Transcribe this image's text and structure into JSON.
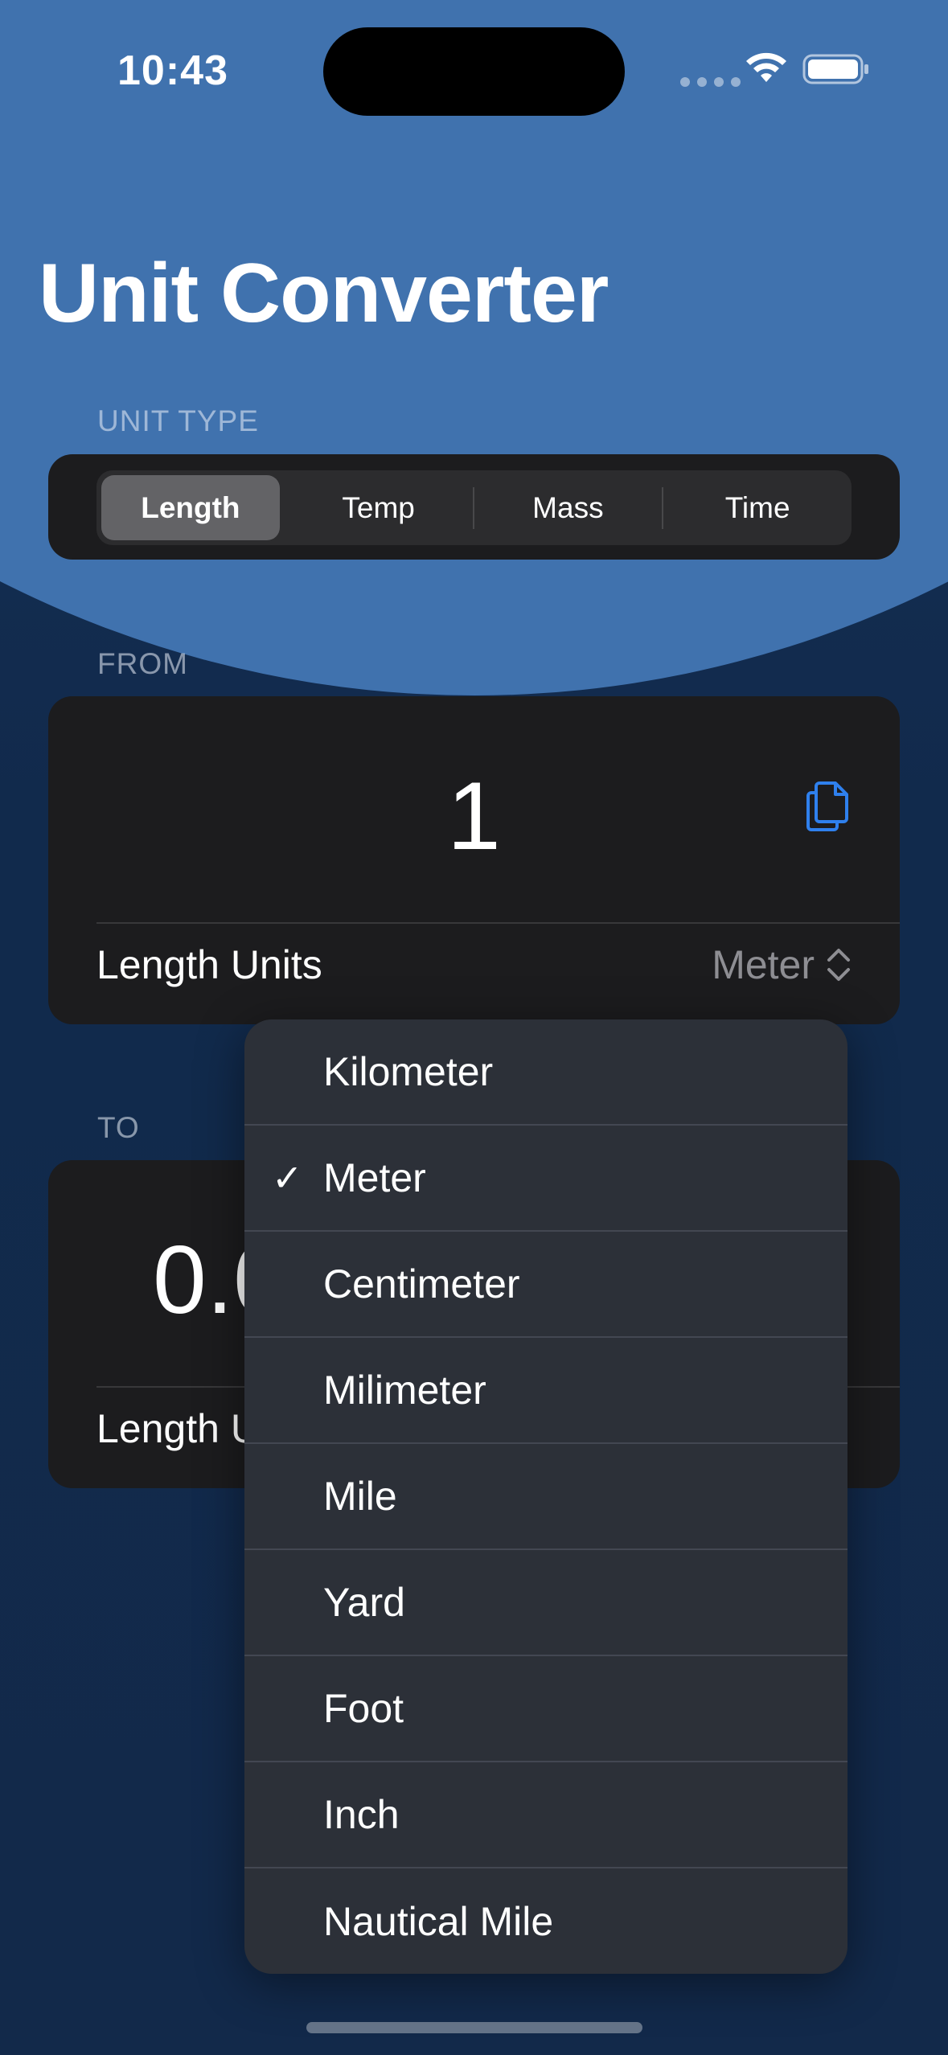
{
  "status_bar": {
    "time": "10:43"
  },
  "title": "Unit Converter",
  "unit_type": {
    "label": "UNIT TYPE",
    "segments": [
      "Length",
      "Temp",
      "Mass",
      "Time"
    ],
    "selected": "Length"
  },
  "from": {
    "label": "FROM",
    "value": "1",
    "units_label": "Length Units",
    "selected_unit": "Meter",
    "copy_icon": "copy-icon"
  },
  "to": {
    "label": "TO",
    "value": "0.0",
    "units_label": "Length U"
  },
  "menu": {
    "items": [
      "Kilometer",
      "Meter",
      "Centimeter",
      "Milimeter",
      "Mile",
      "Yard",
      "Foot",
      "Inch",
      "Nautical Mile"
    ],
    "checked": "Meter",
    "check_mark": "✓"
  },
  "colors": {
    "accent": "#2f80ed",
    "header": "#4072ae",
    "background": "#12294a",
    "card": "#1c1c1e"
  }
}
